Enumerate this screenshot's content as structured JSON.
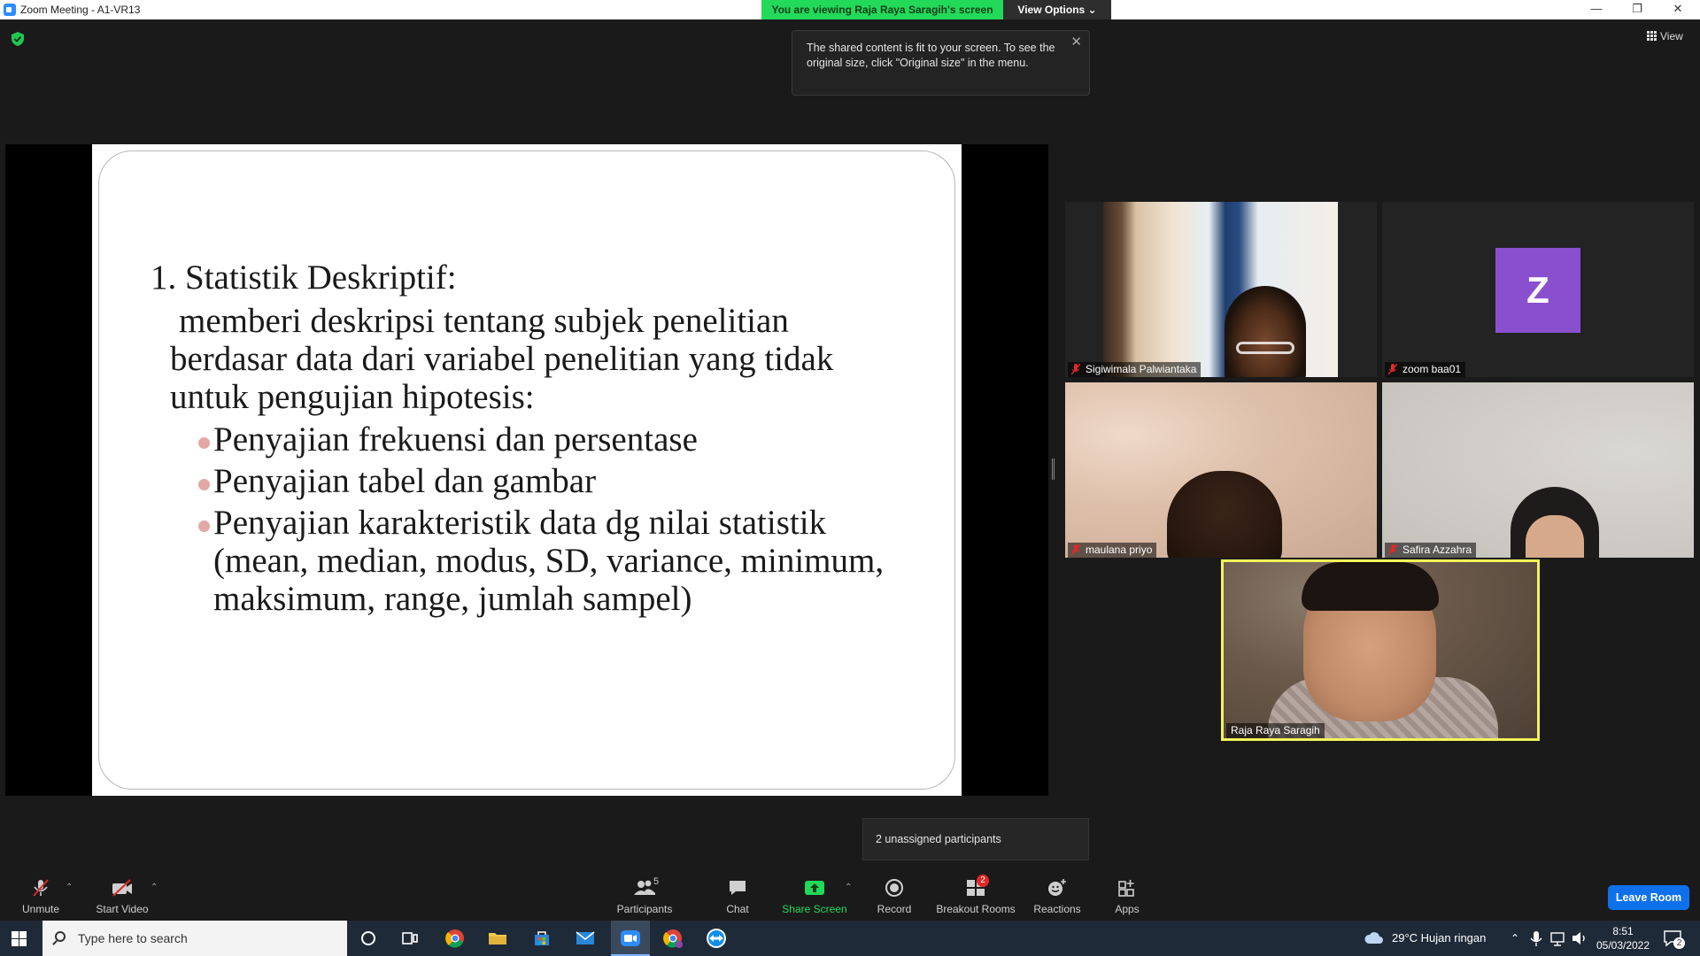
{
  "window": {
    "title": "Zoom Meeting - A1-VR13"
  },
  "banner": {
    "viewing": "You are viewing Raja Raya Saragih's screen",
    "view_options": "View Options ⌄"
  },
  "view_button": "View",
  "tooltip": {
    "text": "The shared content is fit to your screen. To see the original size, click \"Original size\" in the menu.",
    "close": "✕"
  },
  "slide": {
    "heading": "1. Statistik Deskriptif:",
    "lines": [
      "memberi deskripsi tentang subjek  penelitian",
      "berdasar data dari variabel penelitian yang tidak",
      "untuk pengujian hipotesis:"
    ],
    "bullets": [
      "Penyajian frekuensi dan persentase",
      "Penyajian tabel dan gambar",
      "Penyajian karakteristik data dg nilai statistik"
    ],
    "continuation": [
      "(mean, median, modus, SD, variance, minimum,",
      "maksimum, range, jumlah sampel)"
    ],
    "bullet_color": "#e2a8a6"
  },
  "participants_tiles": [
    {
      "name": "Sigiwimala Palwiantaka",
      "muted": true
    },
    {
      "name": "zoom baa01",
      "muted": true,
      "avatar_letter": "Z",
      "avatar_color": "#8a4fcf"
    },
    {
      "name": "maulana priyo",
      "muted": true
    },
    {
      "name": "Safira Azzahra",
      "muted": true
    },
    {
      "name": "Raja Raya Saragih",
      "muted": false,
      "active_speaker": true
    }
  ],
  "unassigned": "2 unassigned participants",
  "toolbar": {
    "unmute": "Unmute",
    "start_video": "Start Video",
    "participants": "Participants",
    "participants_count": "5",
    "chat": "Chat",
    "share_screen": "Share Screen",
    "record": "Record",
    "breakout_rooms": "Breakout Rooms",
    "breakout_badge": "2",
    "reactions": "Reactions",
    "apps": "Apps",
    "leave": "Leave Room"
  },
  "taskbar": {
    "search_placeholder": "Type here to search",
    "weather": "29°C  Hujan ringan",
    "time": "8:51",
    "date": "05/03/2022",
    "notifications": "2"
  },
  "colors": {
    "accent_green": "#23d959",
    "leave_blue": "#0e71eb",
    "speaker_border": "#f3f35a"
  }
}
